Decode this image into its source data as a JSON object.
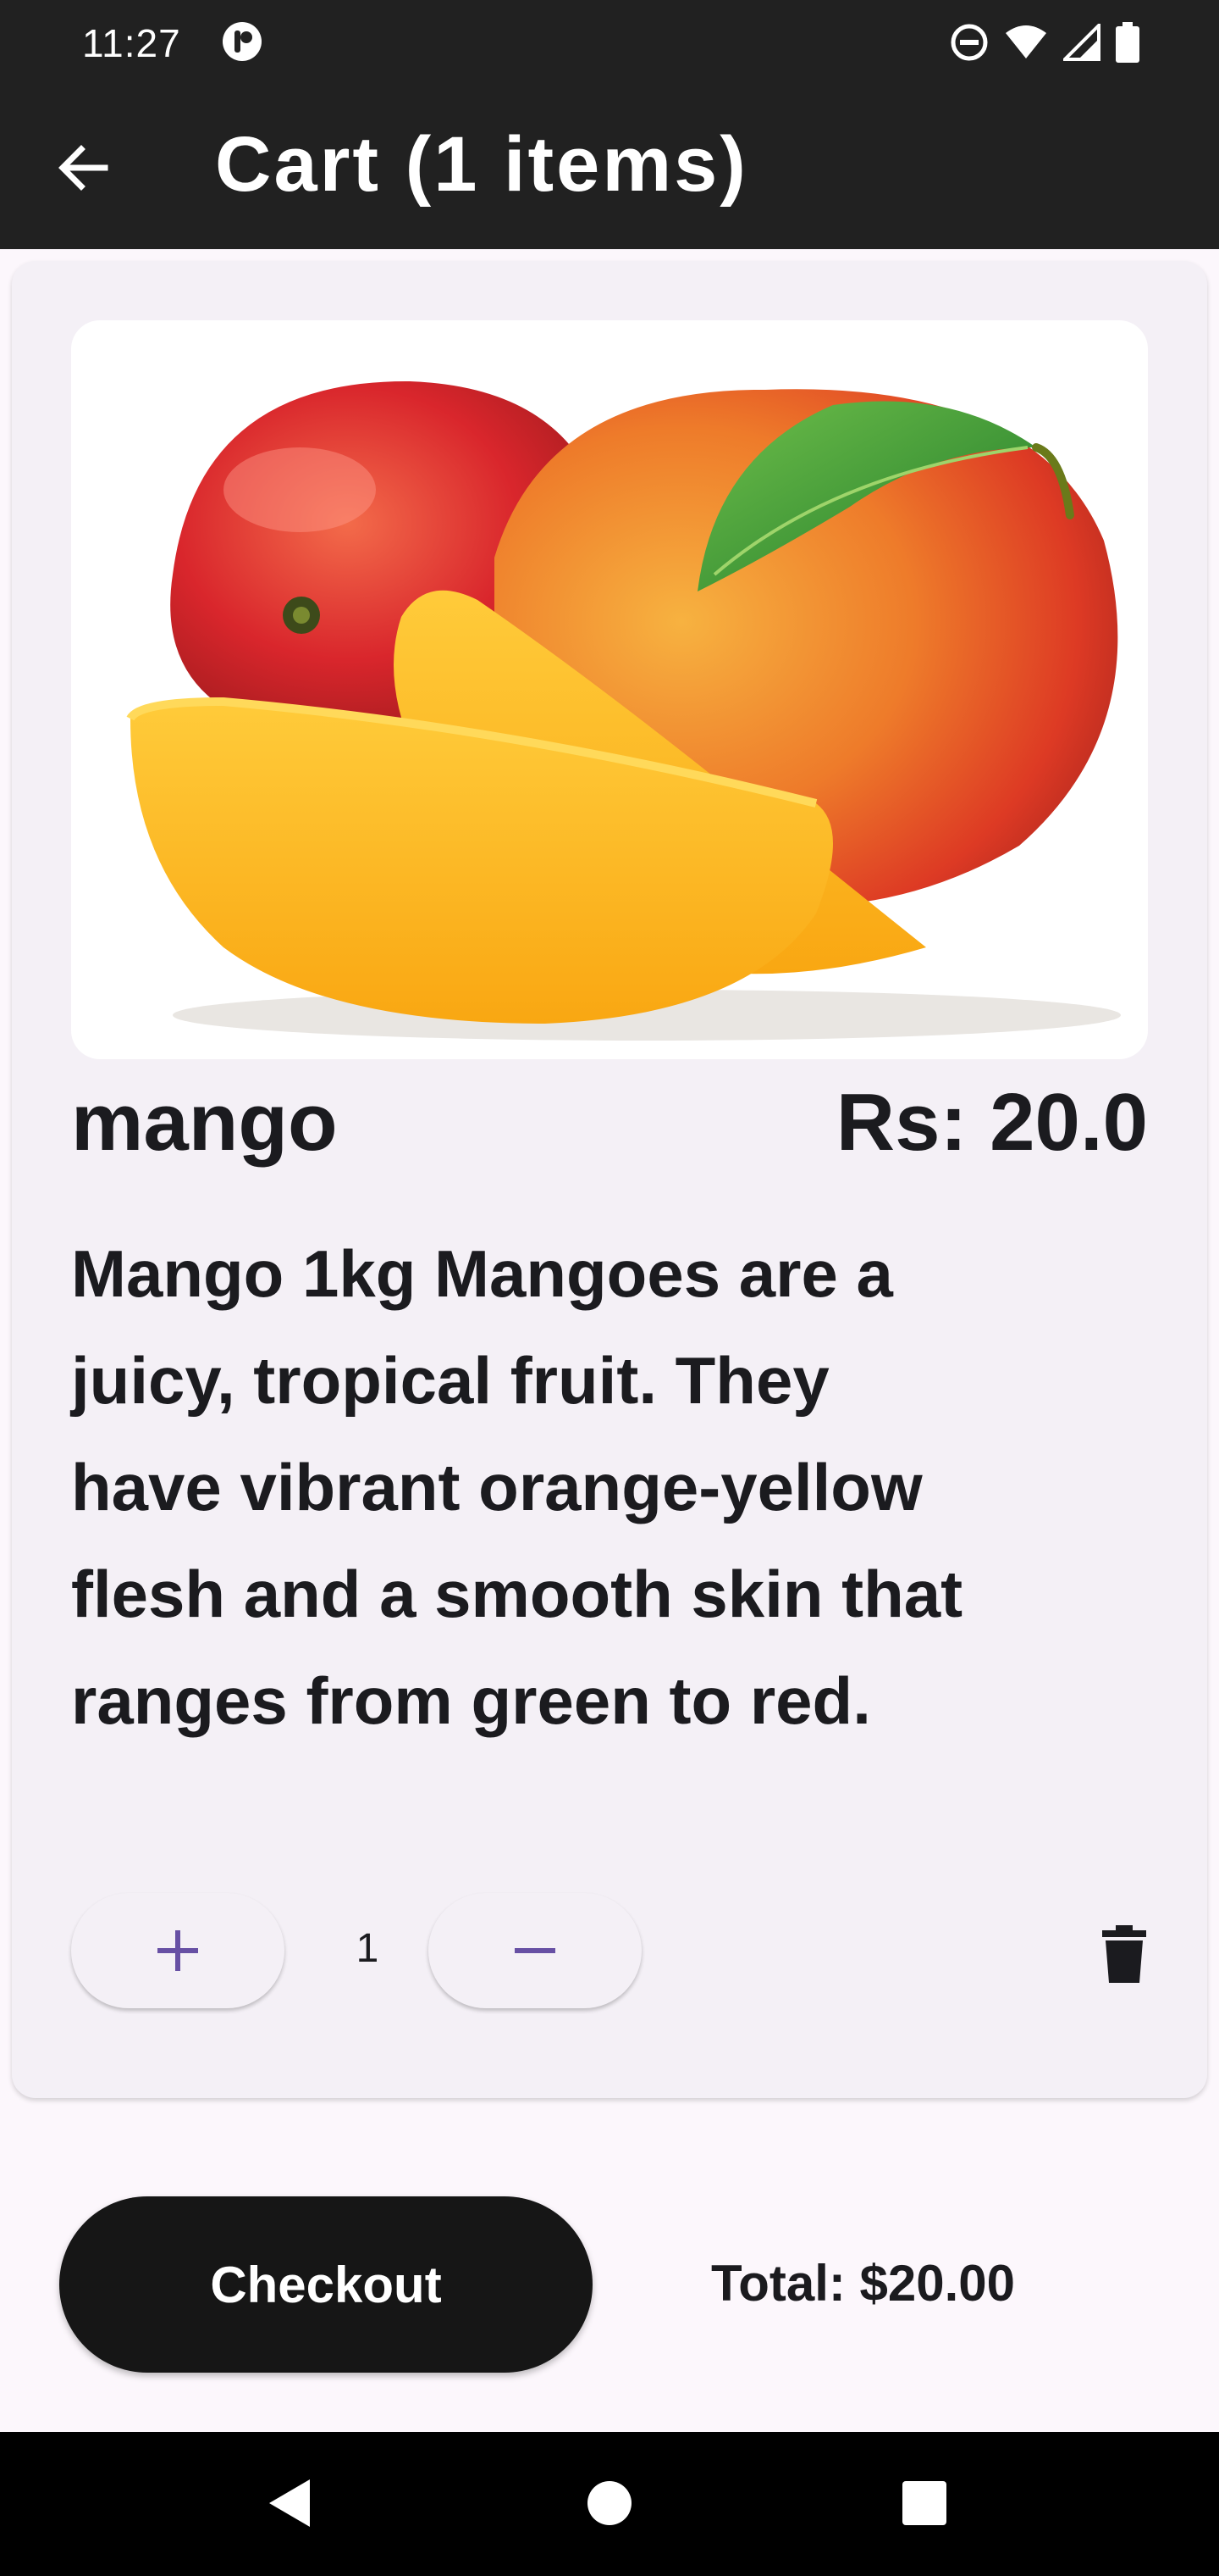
{
  "status_bar": {
    "time": "11:27"
  },
  "app_bar": {
    "title": "Cart (1 items)"
  },
  "cart_item": {
    "name": "mango",
    "price": "Rs: 20.0",
    "description": "Mango 1kg Mangoes are a juicy, tropical fruit. They have vibrant orange-yellow flesh and a smooth skin that ranges from green to red.",
    "quantity": "1"
  },
  "footer": {
    "checkout_label": "Checkout",
    "total": "Total: $20.00"
  },
  "colors": {
    "bar_bg": "#212121",
    "card_bg": "#f4f0f6",
    "accent": "#6750a4",
    "checkout_bg": "#161616"
  }
}
